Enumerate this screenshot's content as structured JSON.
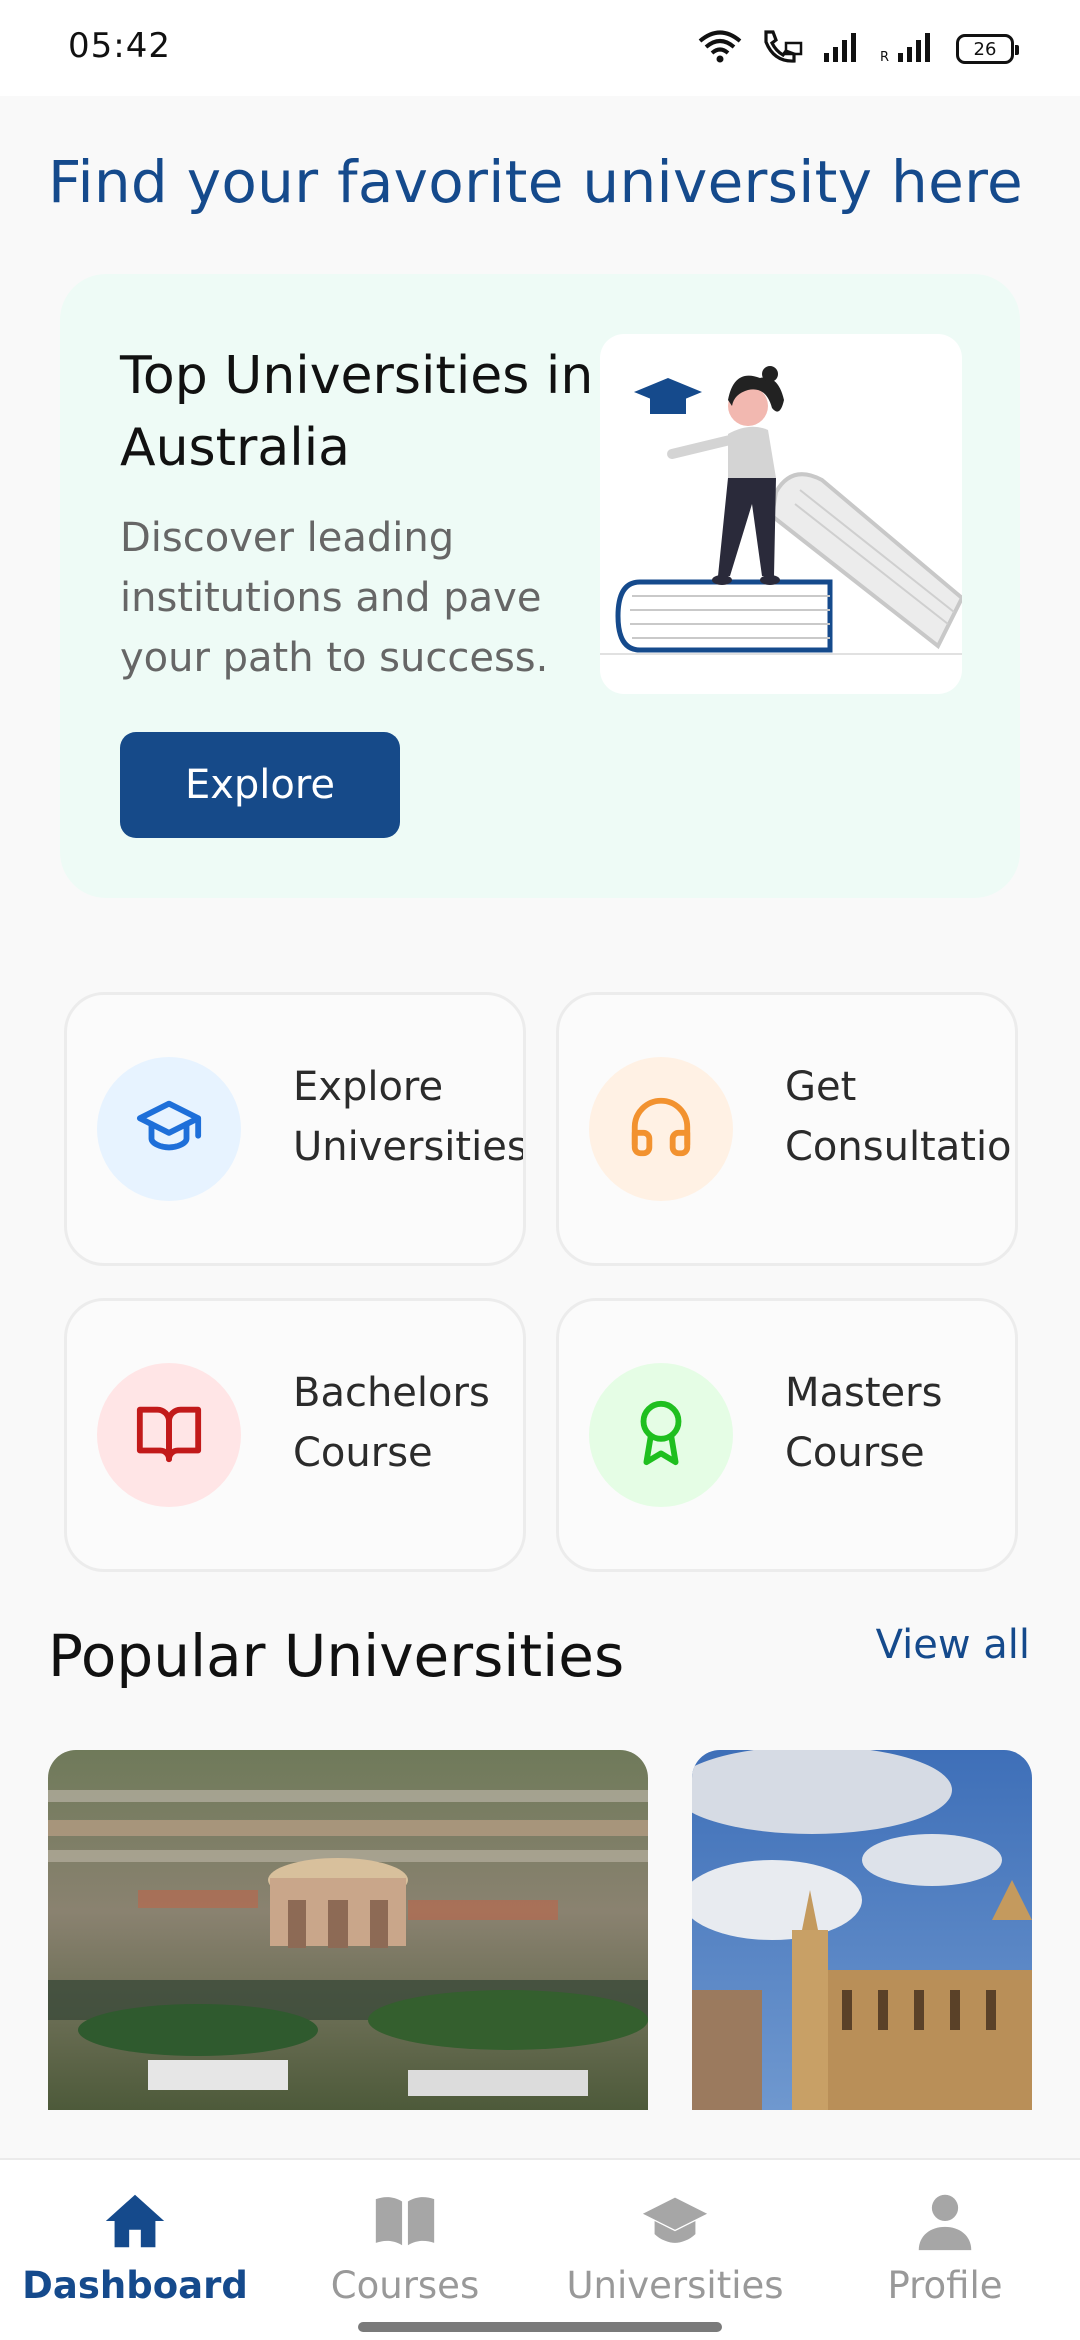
{
  "status_bar": {
    "time": "05:42",
    "battery": "26",
    "icons": [
      "wifi-icon",
      "wifi-call-icon",
      "signal-icon",
      "roaming-signal-icon",
      "battery-icon"
    ]
  },
  "header": {
    "title": "Find your favorite university here"
  },
  "banner": {
    "title": "Top Universities in Australia",
    "description": "Discover leading institutions and pave your path to success.",
    "button_label": "Explore",
    "background": "#eefbf6",
    "button_color": "#164a89"
  },
  "quick_actions": [
    {
      "label": "Explore\nUniversities",
      "icon": "graduation-cap-icon",
      "icon_color": "#1e6fd9",
      "bg": "#e7f3ff"
    },
    {
      "label": "Get\nConsultation",
      "icon": "headphones-icon",
      "icon_color": "#f2922f",
      "bg": "#fff1e4"
    },
    {
      "label": "Bachelors\nCourse",
      "icon": "open-book-icon",
      "icon_color": "#c21a1a",
      "bg": "#ffe5e6"
    },
    {
      "label": "Masters\nCourse",
      "icon": "award-ribbon-icon",
      "icon_color": "#1fbf1f",
      "bg": "#e5fde5"
    }
  ],
  "popular": {
    "title": "Popular Universities",
    "view_all": "View all"
  },
  "bottom_nav": {
    "items": [
      {
        "label": "Dashboard",
        "icon": "home-icon",
        "active": true
      },
      {
        "label": "Courses",
        "icon": "book-icon",
        "active": false
      },
      {
        "label": "Universities",
        "icon": "graduation-cap-icon",
        "active": false
      },
      {
        "label": "Profile",
        "icon": "person-icon",
        "active": false
      }
    ]
  },
  "colors": {
    "primary": "#154a8c",
    "inactive": "#a6a6a6"
  }
}
